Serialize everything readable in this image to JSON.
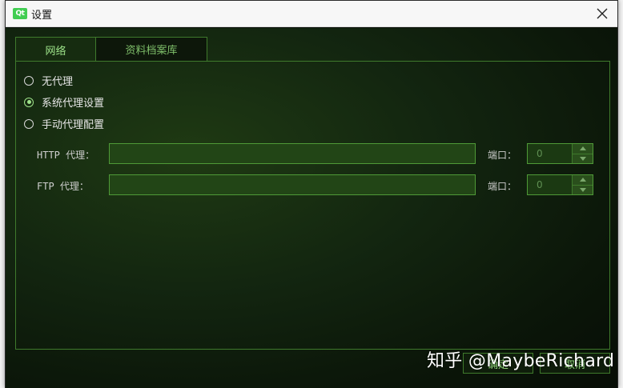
{
  "window": {
    "title": "设置",
    "logo_text": "Qt"
  },
  "tabs": [
    {
      "label": "网络",
      "active": true
    },
    {
      "label": "资料档案库",
      "active": false
    }
  ],
  "proxy_options": [
    {
      "label": "无代理",
      "checked": false
    },
    {
      "label": "系统代理设置",
      "checked": true
    },
    {
      "label": "手动代理配置",
      "checked": false
    }
  ],
  "http": {
    "label": "HTTP 代理：",
    "value": "",
    "port_label": "端口：",
    "port_value": "0"
  },
  "ftp": {
    "label": "FTP 代理：",
    "value": "",
    "port_label": "端口：",
    "port_value": "0"
  },
  "footer": {
    "ok_label": "确定",
    "cancel_label": "取消"
  },
  "watermark": "知乎 @MaybeRichard",
  "colors": {
    "accent": "#9ee38a",
    "border": "#3f7a2c",
    "input_bg": "#224516"
  }
}
